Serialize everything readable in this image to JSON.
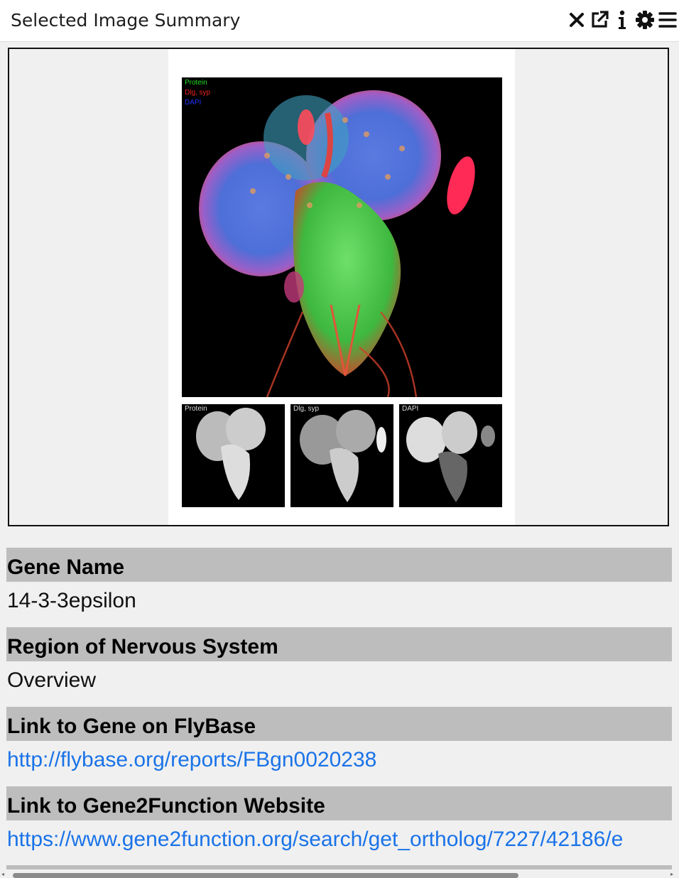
{
  "window": {
    "title": "Selected Image Summary",
    "icons": [
      "close-icon",
      "external-link-icon",
      "info-icon",
      "gear-icon",
      "menu-icon"
    ]
  },
  "figure": {
    "legend": [
      {
        "label": "Protein",
        "color": "#22dd22"
      },
      {
        "label": "Dlg, syp",
        "color": "#ee2222"
      },
      {
        "label": "DAPI",
        "color": "#2233ff"
      }
    ],
    "panels": [
      "Protein",
      "Dlg, syp",
      "DAPI"
    ]
  },
  "fields": [
    {
      "header": "Gene Name",
      "value": "14-3-3epsilon",
      "is_link": false
    },
    {
      "header": "Region of Nervous System",
      "value": "Overview",
      "is_link": false
    },
    {
      "header": "Link to Gene on FlyBase",
      "value": "http://flybase.org/reports/FBgn0020238",
      "is_link": true
    },
    {
      "header": "Link to Gene2Function Website",
      "value": "https://www.gene2function.org/search/get_ortholog/7227/42186/e",
      "is_link": true
    }
  ],
  "colors": {
    "header_bg": "#bdbdbd",
    "link": "#1a73e8",
    "panel_bg": "#f0f0f0"
  }
}
